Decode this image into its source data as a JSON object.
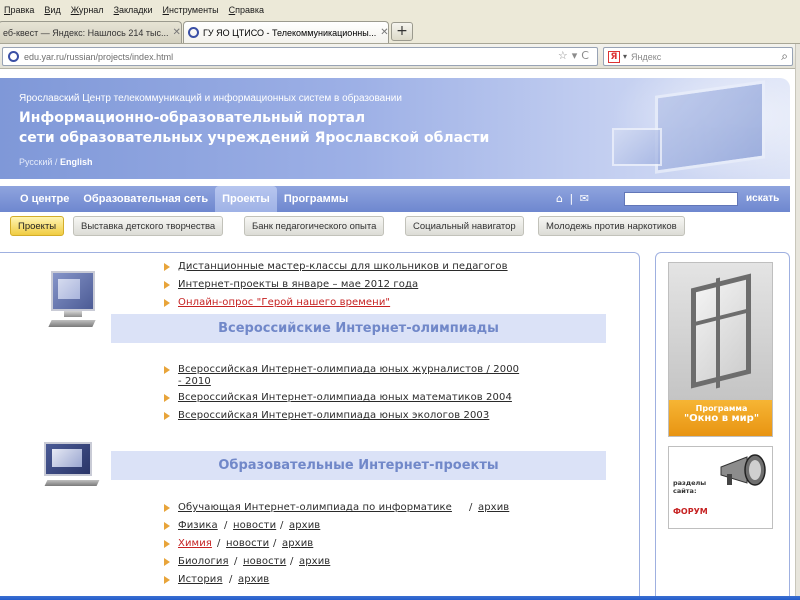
{
  "browser": {
    "menu": [
      "Правка",
      "Вид",
      "Журнал",
      "Закладки",
      "Инструменты",
      "Справка"
    ],
    "tabs": [
      {
        "label": "еб-квест — Яндекс: Нашлось 214 тыс...",
        "active": false
      },
      {
        "label": "ГУ ЯО ЦТИСО - Телекоммуникационны...",
        "active": true
      }
    ],
    "url": "edu.yar.ru/russian/projects/index.html",
    "search_placeholder": "Яндекс",
    "search_engine_icon": "yandex-icon"
  },
  "header": {
    "subtitle": "Ярославский Центр телекоммуникаций и информационных систем в образовании",
    "title_line1": "Информационно-образовательный портал",
    "title_line2": "сети образовательных учреждений Ярославской области",
    "lang_ru": "Русский",
    "lang_sep": "/",
    "lang_en": "English"
  },
  "mainnav": {
    "items": [
      "О центре",
      "Образовательная сеть",
      "Проекты",
      "Программы"
    ],
    "active": "Проекты",
    "home_icon": "home-icon",
    "mail_icon": "mail-icon",
    "search_button": "искать"
  },
  "subnav": {
    "items": [
      "Проекты",
      "Выставка детского творчества",
      "Банк педагогического опыта",
      "Социальный навигатор",
      "Молодежь против наркотиков"
    ],
    "active": "Проекты"
  },
  "main": {
    "top_links": [
      {
        "text": "Дистанционные мастер-классы для школьников и педагогов",
        "color": "#2b2b2b"
      },
      {
        "text": "Интернет-проекты в январе – мае 2012 года",
        "color": "#2b2b2b"
      },
      {
        "text": "Онлайн-опрос \"Герой нашего времени\"",
        "color": "#c62222"
      }
    ],
    "section1": {
      "title": "Всероссийские Интернет-олимпиады",
      "links": [
        {
          "line1": "Всероссийская Интернет-олимпиада юных журналистов / 2000",
          "line2": "- 2010"
        },
        {
          "line1": "Всероссийская Интернет-олимпиада юных математиков 2004"
        },
        {
          "line1": "Всероссийская Интернет-олимпиада юных экологов 2003"
        }
      ]
    },
    "section2": {
      "title": "Образовательные Интернет-проекты",
      "rows": [
        {
          "main": "Обучающая Интернет-олимпиада по информатике",
          "sep1": "/",
          "archive": "архив"
        },
        {
          "main": "Физика",
          "sep1": "/",
          "news": "новости",
          "sep2": "/",
          "archive": "архив"
        },
        {
          "main": "Химия",
          "sep1": "/",
          "news": "новости",
          "sep2": "/",
          "archive": "архив"
        },
        {
          "main": "Биология",
          "sep1": "/",
          "news": "новости",
          "sep2": "/",
          "archive": "архив"
        },
        {
          "main": "История",
          "sep1": "/",
          "archive": "архив"
        }
      ]
    }
  },
  "sidebar": {
    "program_label1": "Программа",
    "program_label2": "\"Окно в мир\"",
    "forum_caption1": "разделы",
    "forum_caption2": "сайта:",
    "forum_link": "ФОРУМ"
  },
  "colors": {
    "accent_blue": "#7f98d8",
    "nav_blue": "#6e87cf",
    "section_bar": "#dbe2f7",
    "section_title": "#7188c9",
    "bullet_orange": "#e8a43a",
    "highlight_red": "#c62222",
    "subnav_active": "#f0cc42"
  }
}
